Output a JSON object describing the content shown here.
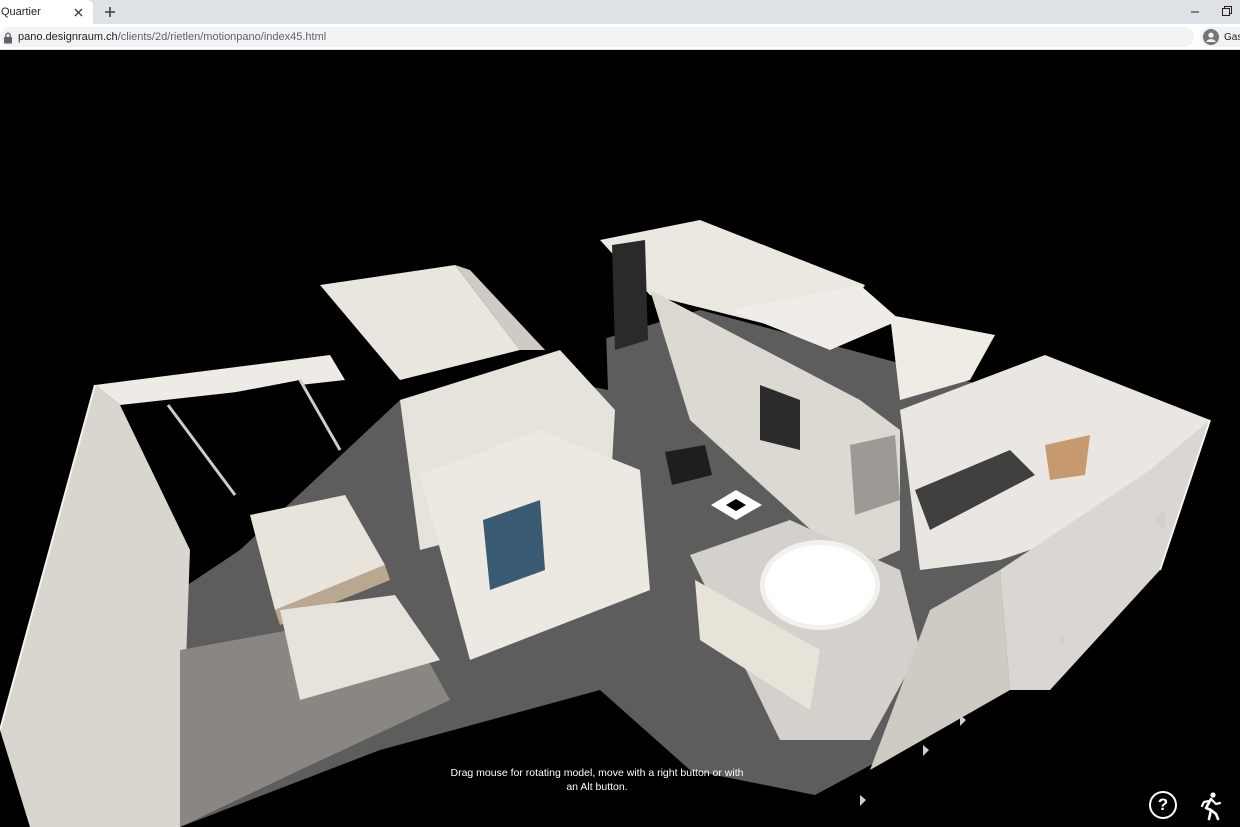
{
  "browser": {
    "tab_title": "Quartier",
    "tab_close_icon": "close-icon",
    "new_tab_icon": "plus-icon",
    "url_host": "pano.designraum.ch",
    "url_path": "/clients/2d/rietlen/motionpano/index45.html",
    "profile_name": "Gast"
  },
  "viewer": {
    "navigation_hint": "Drag mouse for rotating model, move with a right button or with an Alt button.",
    "help_label": "?",
    "help_icon": "help-icon",
    "walk_icon": "walk-mode-icon",
    "background_color": "#000000"
  }
}
